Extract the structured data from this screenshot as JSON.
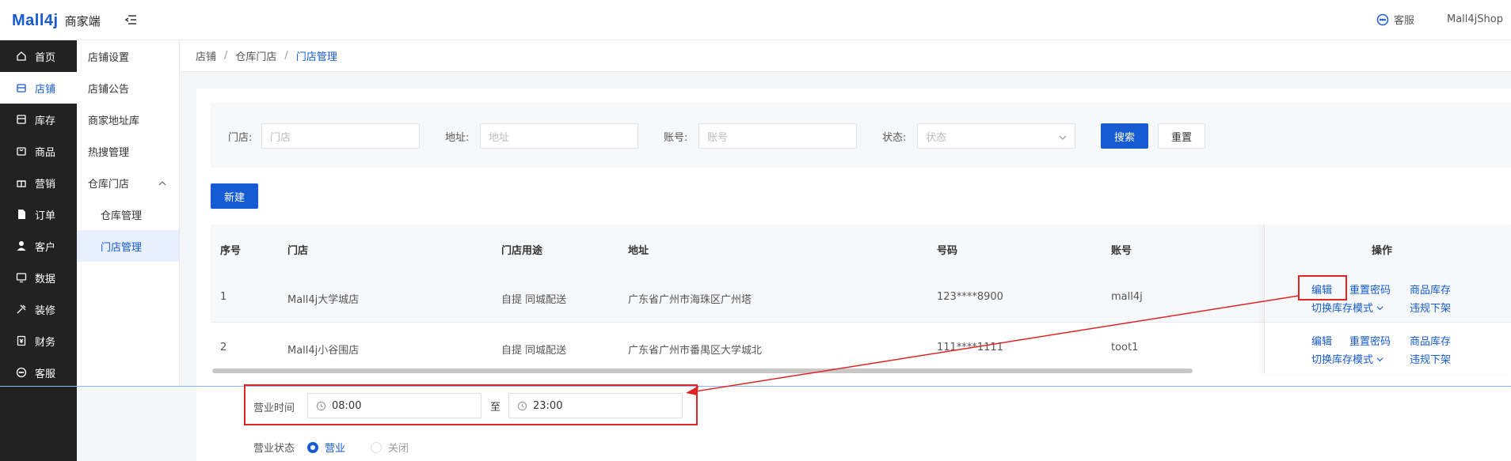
{
  "header": {
    "logo_text": "Mall4j",
    "logo_sub": "商家端",
    "service_label": "客服",
    "shop_name": "Mall4jShop"
  },
  "sidebar": {
    "items": [
      {
        "label": "首页",
        "icon": "home-icon"
      },
      {
        "label": "店铺",
        "icon": "store-icon"
      },
      {
        "label": "库存",
        "icon": "inventory-icon"
      },
      {
        "label": "商品",
        "icon": "product-icon"
      },
      {
        "label": "营销",
        "icon": "gift-icon"
      },
      {
        "label": "订单",
        "icon": "order-icon"
      },
      {
        "label": "客户",
        "icon": "user-icon"
      },
      {
        "label": "数据",
        "icon": "data-icon"
      },
      {
        "label": "装修",
        "icon": "decorate-icon"
      },
      {
        "label": "财务",
        "icon": "finance-icon"
      },
      {
        "label": "客服",
        "icon": "chat-icon"
      }
    ],
    "active_index": 1
  },
  "submenu": {
    "items": [
      {
        "label": "店铺设置"
      },
      {
        "label": "店铺公告"
      },
      {
        "label": "商家地址库"
      },
      {
        "label": "热搜管理"
      },
      {
        "label": "仓库门店"
      },
      {
        "label": "仓库管理"
      },
      {
        "label": "门店管理"
      }
    ]
  },
  "breadcrumb": {
    "items": [
      "店铺",
      "仓库门店",
      "门店管理"
    ],
    "separator": "/"
  },
  "search": {
    "store_label": "门店:",
    "store_placeholder": "门店",
    "address_label": "地址:",
    "address_placeholder": "地址",
    "account_label": "账号:",
    "account_placeholder": "账号",
    "status_label": "状态:",
    "status_placeholder": "状态",
    "search_button": "搜索",
    "reset_button": "重置"
  },
  "toolbar": {
    "new_button": "新建"
  },
  "table": {
    "columns": [
      "序号",
      "门店",
      "门店用途",
      "地址",
      "号码",
      "账号",
      "操作"
    ],
    "rows": [
      {
        "index": "1",
        "store": "Mall4j大学城店",
        "usage": "自提 同城配送",
        "address": "广东省广州市海珠区广州塔",
        "phone": "123****8900",
        "account": "mall4j"
      },
      {
        "index": "2",
        "store": "Mall4j小谷围店",
        "usage": "自提 同城配送",
        "address": "广东省广州市番禺区大学城北",
        "phone": "111****1111",
        "account": "toot1"
      }
    ],
    "ops": {
      "edit": "编辑",
      "reset_password": "重置密码",
      "product_stock": "商品库存",
      "switch_stock_mode": "切换库存模式",
      "violation_offline": "违规下架"
    }
  },
  "form": {
    "hours_label": "营业时间",
    "start_time": "08:00",
    "to_label": "至",
    "end_time": "23:00",
    "status_label": "营业状态",
    "status_open": "营业",
    "status_closed": "关闭"
  },
  "colors": {
    "primary": "#155bd4",
    "sidebar_bg": "#222222",
    "annotation_red": "#e02424"
  }
}
